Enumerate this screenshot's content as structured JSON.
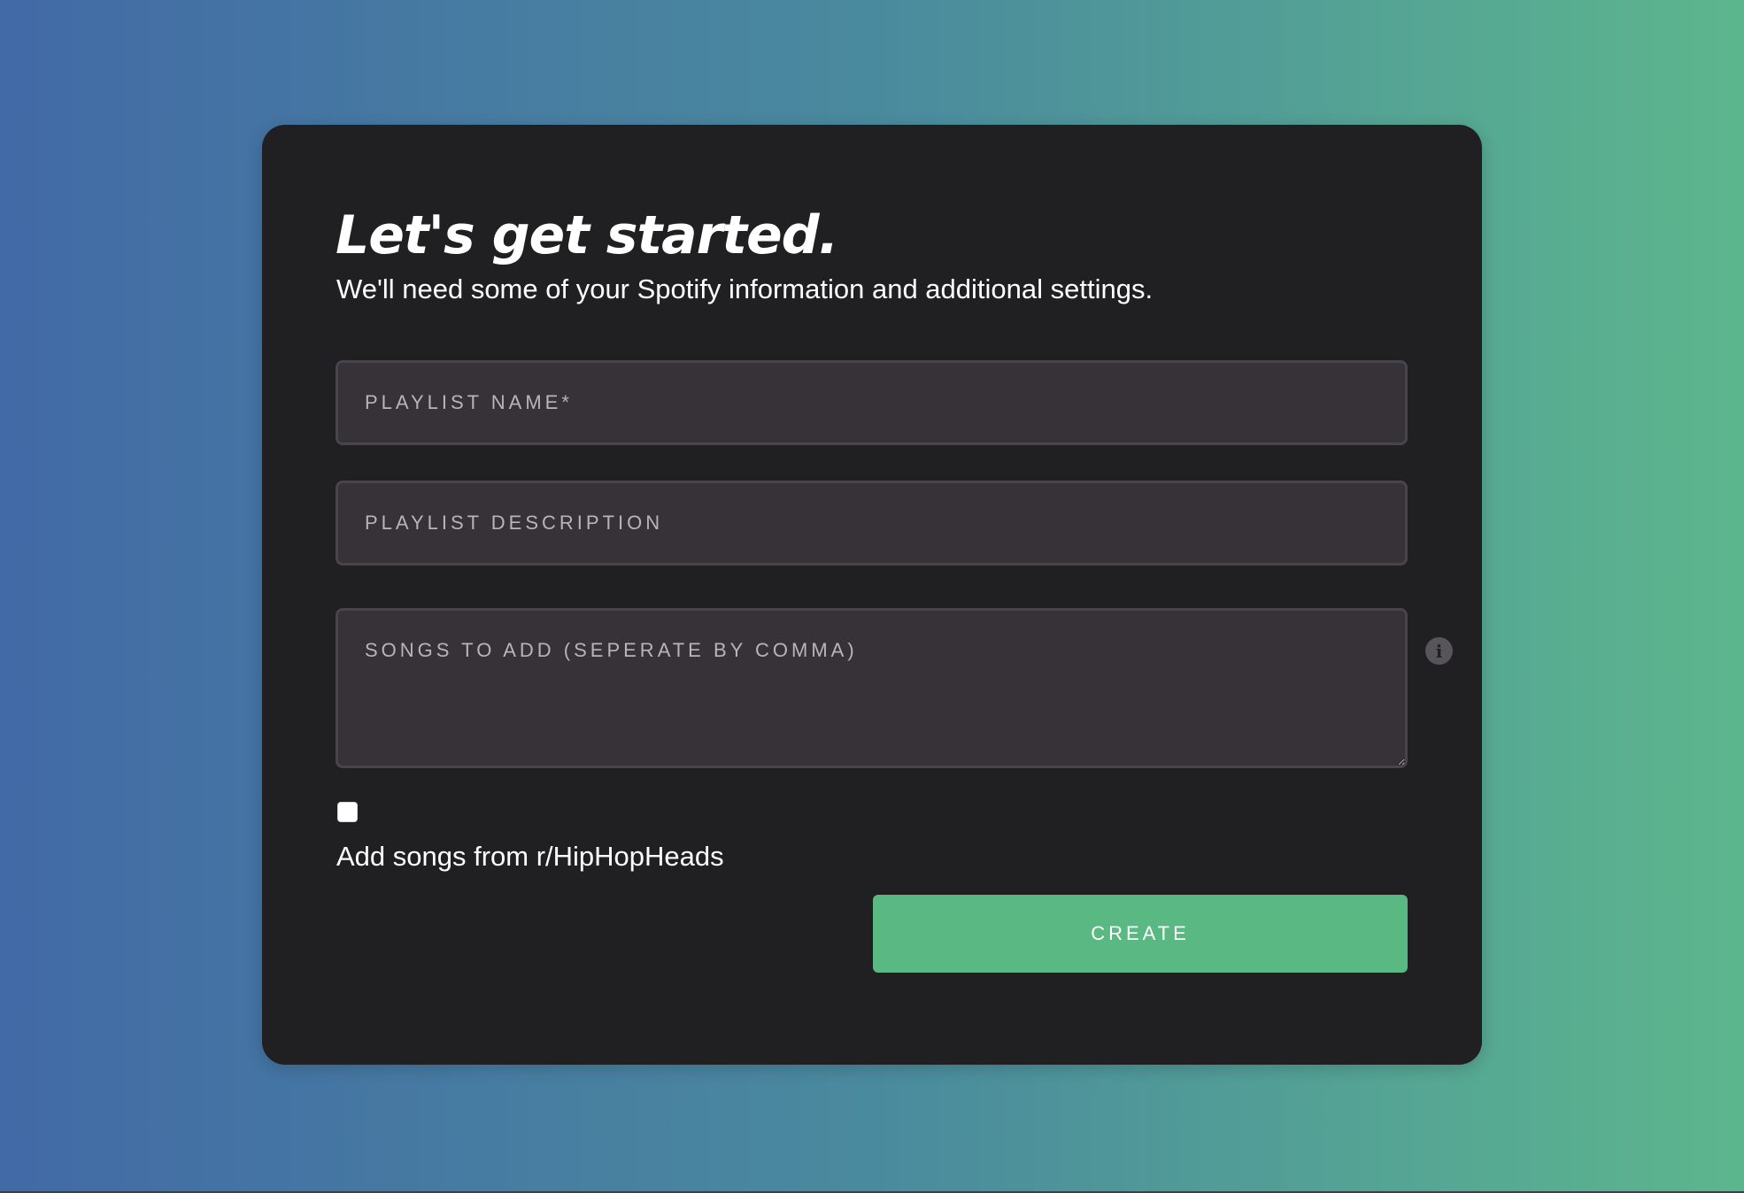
{
  "form": {
    "title": "Let's get started.",
    "subtitle": "We'll need some of your Spotify information and additional settings.",
    "playlist_name_placeholder": "PLAYLIST NAME*",
    "playlist_description_placeholder": "PLAYLIST DESCRIPTION",
    "songs_placeholder": "SONGS TO ADD (SEPERATE BY COMMA)",
    "info_icon": "i",
    "checkbox_checked": false,
    "checkbox_label": "Add songs from r/HipHopHeads",
    "create_label": "CREATE"
  },
  "colors": {
    "gradient_start": "#426aa6",
    "gradient_end": "#5cb68d",
    "card_background": "#201f22",
    "field_background": "#363238",
    "accent_button": "#5ab882"
  },
  "icons": {
    "info": "info-icon"
  }
}
